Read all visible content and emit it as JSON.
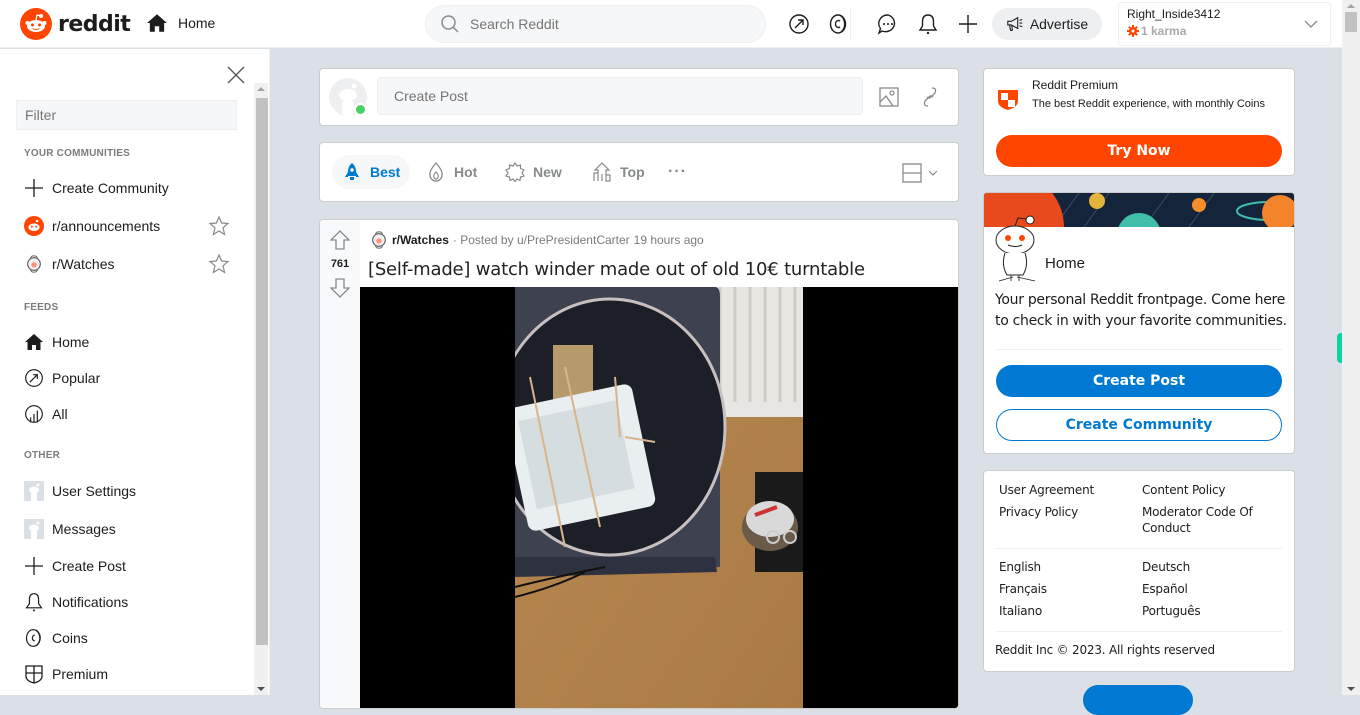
{
  "header": {
    "logo_text": "reddit",
    "current_feed": "Home",
    "search_placeholder": "Search Reddit",
    "advertise_label": "Advertise",
    "user": {
      "name": "Right_Inside3412",
      "karma": "1 karma"
    },
    "icons": [
      "popular-icon",
      "coins-icon",
      "chat-icon",
      "notifications-icon",
      "create-post-icon"
    ]
  },
  "sidebar": {
    "filter_placeholder": "Filter",
    "sections": {
      "communities": "YOUR COMMUNITIES",
      "feeds": "FEEDS",
      "other": "OTHER"
    },
    "communities": [
      {
        "label": "Create Community",
        "icon": "plus-icon"
      },
      {
        "label": "r/announcements",
        "icon": "reddit-icon"
      },
      {
        "label": "r/Watches",
        "icon": "watches-icon"
      }
    ],
    "feeds": [
      {
        "label": "Home",
        "icon": "home-icon"
      },
      {
        "label": "Popular",
        "icon": "popular-icon"
      },
      {
        "label": "All",
        "icon": "all-icon"
      }
    ],
    "other": [
      {
        "label": "User Settings",
        "icon": "avatar-icon"
      },
      {
        "label": "Messages",
        "icon": "avatar-icon"
      },
      {
        "label": "Create Post",
        "icon": "plus-icon"
      },
      {
        "label": "Notifications",
        "icon": "bell-icon"
      },
      {
        "label": "Coins",
        "icon": "coins-icon"
      },
      {
        "label": "Premium",
        "icon": "shield-icon"
      }
    ]
  },
  "create_post": {
    "placeholder": "Create Post"
  },
  "sort": {
    "tabs": [
      {
        "label": "Best",
        "active": true
      },
      {
        "label": "Hot",
        "active": false
      },
      {
        "label": "New",
        "active": false
      },
      {
        "label": "Top",
        "active": false
      }
    ],
    "more": "···"
  },
  "post": {
    "votes": "761",
    "subreddit": "r/Watches",
    "posted_by": "· Posted by u/PrePresidentCarter",
    "time": "19 hours ago",
    "title": "[Self-made] watch winder made out of old 10€ turntable"
  },
  "premium": {
    "title": "Reddit Premium",
    "description": "The best Reddit experience, with monthly Coins",
    "button": "Try Now"
  },
  "home_card": {
    "title": "Home",
    "description": "Your personal Reddit frontpage. Come here to check in with your favorite communities.",
    "create_post": "Create Post",
    "create_community": "Create Community"
  },
  "footer": {
    "links_left": [
      "User Agreement",
      "Privacy Policy"
    ],
    "links_right": [
      "Content Policy",
      "Moderator Code Of Conduct"
    ],
    "languages_left": [
      "English",
      "Français",
      "Italiano"
    ],
    "languages_right": [
      "Deutsch",
      "Español",
      "Português"
    ],
    "copyright": "Reddit Inc © 2023. All rights reserved"
  },
  "colors": {
    "brand": "#ff4500",
    "accent": "#0079d3",
    "online": "#46d160"
  }
}
